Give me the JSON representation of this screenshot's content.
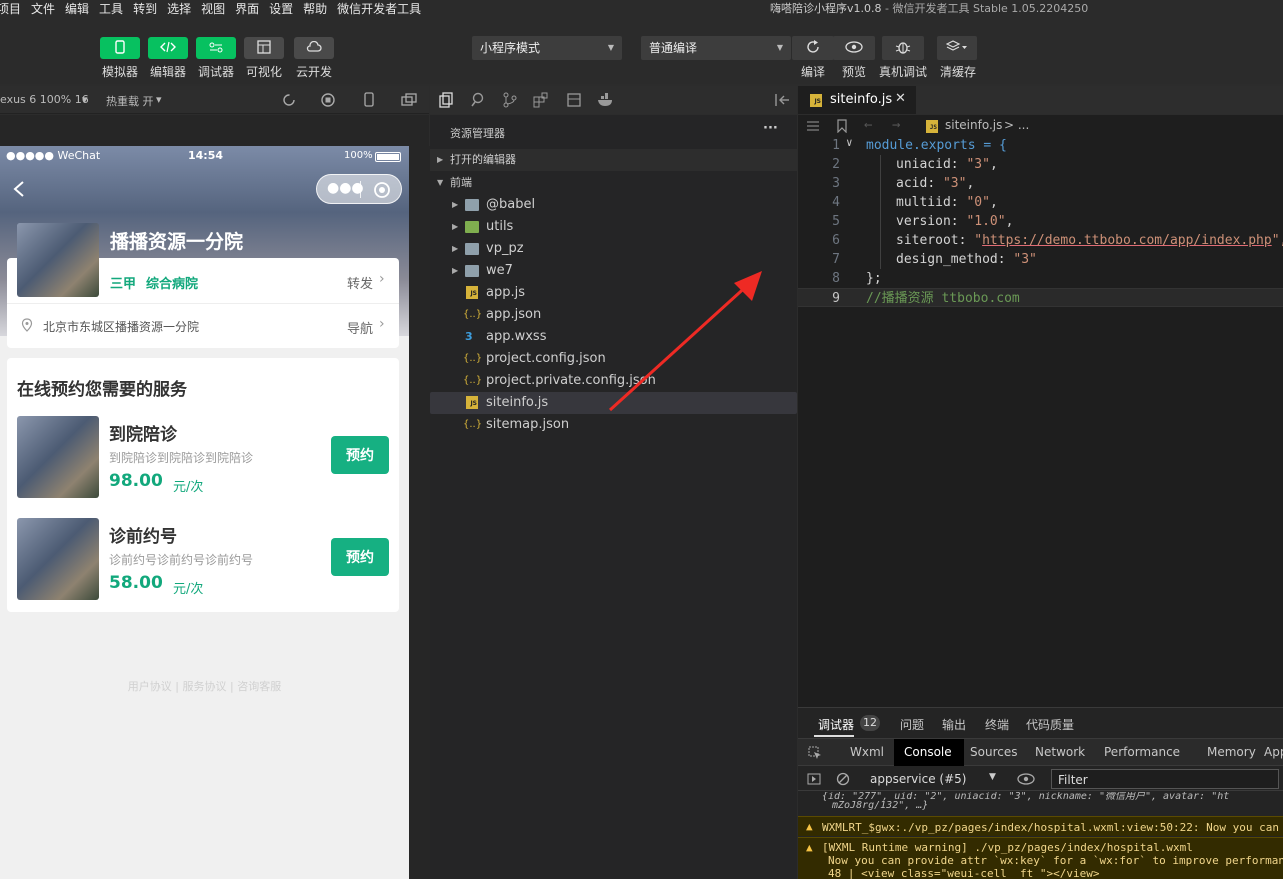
{
  "menu": [
    "项目",
    "文件",
    "编辑",
    "工具",
    "转到",
    "选择",
    "视图",
    "界面",
    "设置",
    "帮助",
    "微信开发者工具"
  ],
  "window_title": {
    "app": "嗨嗒陪诊小程序v1.0.8",
    "rest": " - 微信开发者工具 Stable 1.05.2204250"
  },
  "toolbar": {
    "left_buttons": [
      {
        "label": "模拟器",
        "icon": "phone-icon",
        "active": true
      },
      {
        "label": "编辑器",
        "icon": "code-icon",
        "active": true
      },
      {
        "label": "调试器",
        "icon": "debug-toggle-icon",
        "active": true
      },
      {
        "label": "可视化",
        "icon": "layout-icon",
        "active": false
      },
      {
        "label": "云开发",
        "icon": "cloud-icon",
        "active": false
      }
    ],
    "mode_select": "小程序模式",
    "compile_select": "普通编译",
    "right_buttons": [
      {
        "label": "编译",
        "icon": "refresh-icon"
      },
      {
        "label": "预览",
        "icon": "eye-icon"
      },
      {
        "label": "真机调试",
        "icon": "bug-icon"
      },
      {
        "label": "清缓存",
        "icon": "layers-icon"
      }
    ]
  },
  "simulator_bar": {
    "device": "exus 6 100% 16",
    "hot_reload": "热重载 开"
  },
  "phone": {
    "status": {
      "carrier": "●●●●● WeChat",
      "time": "14:54",
      "battery": "100%"
    },
    "hospital_name": "播播资源一分院",
    "level": "三甲",
    "type": "综合病院",
    "share": "转发",
    "address": "北京市东城区播播资源一分院",
    "navigate": "导航",
    "section_title": "在线预约您需要的服务",
    "services": [
      {
        "name": "到院陪诊",
        "desc": "到院陪诊到院陪诊到院陪诊",
        "price": "98.00",
        "unit": "元/次",
        "button": "预约"
      },
      {
        "name": "诊前约号",
        "desc": "诊前约号诊前约号诊前约号",
        "price": "58.00",
        "unit": "元/次",
        "button": "预约"
      }
    ],
    "footer": "用户协议 | 服务协议 | 咨询客服"
  },
  "explorer": {
    "title": "资源管理器",
    "more": "···",
    "open_editors": "打开的编辑器",
    "project": "前端",
    "items": [
      {
        "name": "@babel",
        "kind": "folder"
      },
      {
        "name": "utils",
        "kind": "folder"
      },
      {
        "name": "vp_pz",
        "kind": "folder"
      },
      {
        "name": "we7",
        "kind": "folder"
      },
      {
        "name": "app.js",
        "kind": "js"
      },
      {
        "name": "app.json",
        "kind": "json"
      },
      {
        "name": "app.wxss",
        "kind": "css"
      },
      {
        "name": "project.config.json",
        "kind": "json"
      },
      {
        "name": "project.private.config.json",
        "kind": "json"
      },
      {
        "name": "siteinfo.js",
        "kind": "js",
        "selected": true
      },
      {
        "name": "sitemap.json",
        "kind": "json"
      }
    ]
  },
  "editor": {
    "tab": "siteinfo.js",
    "breadcrumb": "siteinfo.js",
    "breadcrumb_more": "> ...",
    "line_numbers": [
      "1",
      "2",
      "3",
      "4",
      "5",
      "6",
      "7",
      "8",
      "9"
    ],
    "fields": [
      {
        "key": "uniacid",
        "value": "\"3\""
      },
      {
        "key": "acid",
        "value": "\"3\""
      },
      {
        "key": "multiid",
        "value": "\"0\""
      },
      {
        "key": "version",
        "value": "\"1.0\""
      },
      {
        "key": "siteroot",
        "value": "https://demo.ttbobo.com/app/index.php"
      },
      {
        "key": "design_method",
        "value": "\"3\""
      }
    ],
    "line1": "module.exports = {",
    "line8": "};",
    "comment": "//播播资源 ttbobo.com"
  },
  "devtools": {
    "top_tabs": [
      "调试器",
      "问题",
      "输出",
      "终端",
      "代码质量"
    ],
    "badge": "12",
    "panel_tabs": [
      "Wxml",
      "Console",
      "Sources",
      "Network",
      "Performance",
      "Memory",
      "App"
    ],
    "active_panel": "Console",
    "context": "appservice (#5)",
    "filter_placeholder": "Filter",
    "log_line1": "{id: \"277\", uid: \"2\", uniacid: \"3\", nickname: \"微信用户\", avatar: \"ht",
    "log_line2": "mZoJ8rg/132\", …}",
    "warn1": "WXMLRT_$gwx:./vp_pz/pages/index/hospital.wxml:view:50:22: Now you can",
    "warn2_a": "[WXML Runtime warning] ./vp_pz/pages/index/hospital.wxml",
    "warn2_b": "Now you can provide attr `wx:key` for a `wx:for` to improve performan",
    "warn2_c": " 48 |                       <view class=\"weui-cell__ft \"></view>"
  }
}
